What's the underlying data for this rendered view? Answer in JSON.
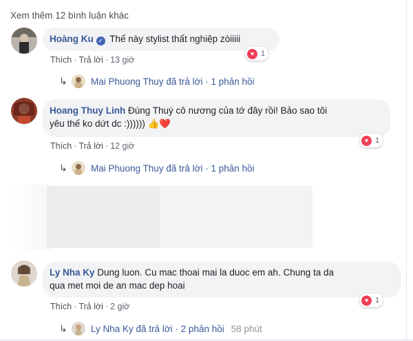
{
  "see_more": "Xem thêm 12 bình luận khác",
  "comments": [
    {
      "name": "Hoàng Ku",
      "verified": true,
      "text": "Thế này stylist thất nghiệp zòiiiii",
      "reactions": "1",
      "action_like": "Thích",
      "action_reply": "Trả lời",
      "time": "13 giờ",
      "reply_summary": {
        "author": "Mai Phuong Thuy",
        "action": "đã trả lời",
        "count": "1 phản hồi"
      }
    },
    {
      "name": "Hoang Thuy Linh",
      "text_line1": "Đúng Thuý cô nương của tớ đây rồi! Bảo sao tôi",
      "text_line2": "yêu thế ko dứt dc :)))))) 👍❤️",
      "reactions": "1",
      "action_like": "Thích",
      "action_reply": "Trả lời",
      "time": "12 giờ",
      "reply_summary": {
        "author": "Mai Phuong Thuy",
        "action": "đã trả lời",
        "count": "1 phản hồi"
      }
    },
    {
      "name": "Ly Nha Ky",
      "text_line1": "Dung luon. Cu mac thoai mai la duoc em ah. Chung ta da",
      "text_line2": "qua met moi de an mac dep hoai",
      "reactions": "1",
      "action_like": "Thích",
      "action_reply": "Trả lời",
      "time": "2 giờ",
      "reply_summary": {
        "author": "Ly Nha Ky",
        "action": "đã trả lời",
        "count": "2 phản hồi",
        "time": "58 phút"
      }
    }
  ],
  "colors": {
    "link": "#385898",
    "bubble": "#f2f3f5",
    "muted": "#606770",
    "heart": "#f33e58",
    "verified": "#4267b2"
  },
  "icons": {
    "reply_arrow": "reply-arrow-icon",
    "heart": "heart-reaction-icon",
    "verified": "verified-badge-icon"
  }
}
